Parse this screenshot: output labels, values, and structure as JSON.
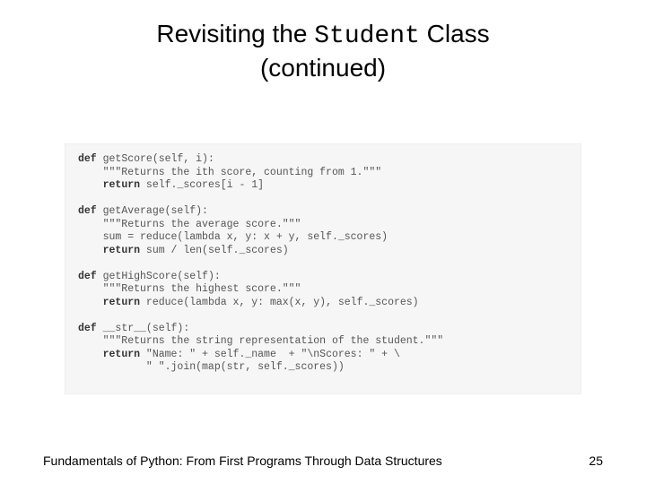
{
  "title": {
    "part1": "Revisiting the ",
    "mono": "Student",
    "part2": " Class",
    "line2": "(continued)"
  },
  "code": {
    "l01a": "def",
    "l01b": " getScore(self, i):",
    "l02": "    \"\"\"Returns the ith score, counting from 1.\"\"\"",
    "l03a": "    ",
    "l03b": "return",
    "l03c": " self._scores[i - 1]",
    "l04": "",
    "l05a": "def",
    "l05b": " getAverage(self):",
    "l06": "    \"\"\"Returns the average score.\"\"\"",
    "l07": "    sum = reduce(lambda x, y: x + y, self._scores)",
    "l08a": "    ",
    "l08b": "return",
    "l08c": " sum / len(self._scores)",
    "l09": "",
    "l10a": "def",
    "l10b": " getHighScore(self):",
    "l11": "    \"\"\"Returns the highest score.\"\"\"",
    "l12a": "    ",
    "l12b": "return",
    "l12c": " reduce(lambda x, y: max(x, y), self._scores)",
    "l13": "",
    "l14a": "def",
    "l14b": " __str__(self):",
    "l15": "    \"\"\"Returns the string representation of the student.\"\"\"",
    "l16a": "    ",
    "l16b": "return",
    "l16c": " \"Name: \" + self._name  + \"\\nScores: \" + \\",
    "l17": "           \" \".join(map(str, self._scores))"
  },
  "footer": {
    "book": "Fundamentals of Python: From First Programs Through Data Structures",
    "page": "25"
  }
}
